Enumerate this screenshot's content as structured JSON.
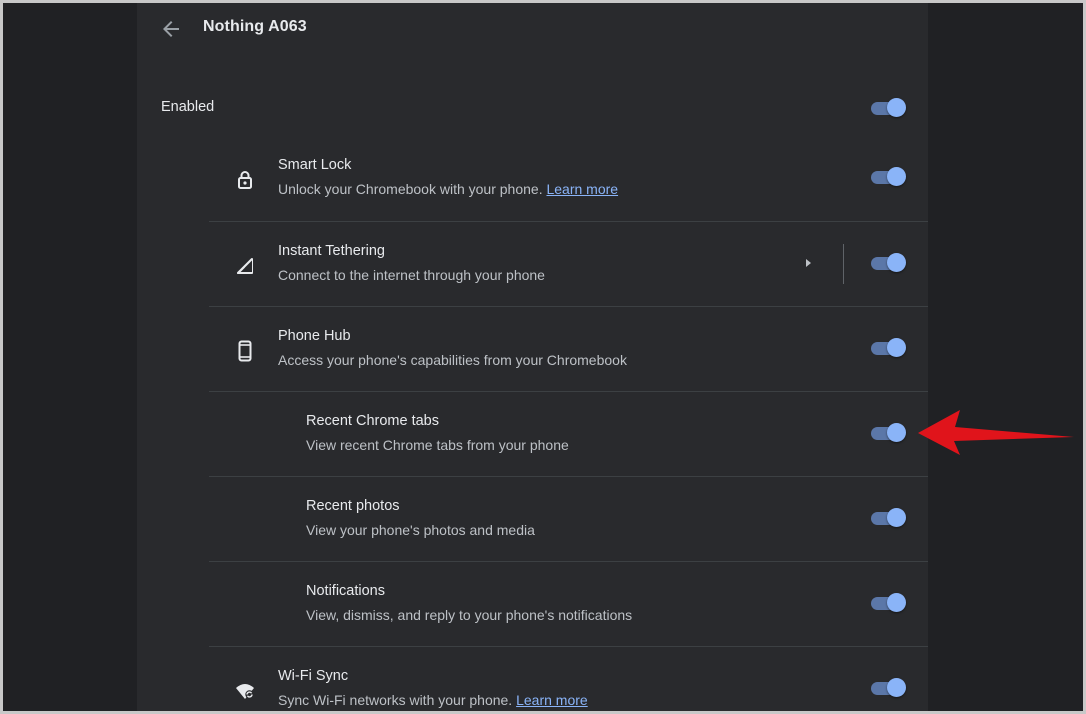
{
  "header": {
    "title": "Nothing A063"
  },
  "enabled": {
    "label": "Enabled",
    "on": true
  },
  "features": [
    {
      "name": "smart-lock",
      "label": "Smart Lock",
      "description": "Unlock your Chromebook with your phone.",
      "link": "Learn more",
      "icon": "lock-icon",
      "on": true
    },
    {
      "name": "instant-tethering",
      "label": "Instant Tethering",
      "description": "Connect to the internet through your phone",
      "icon": "signal-icon",
      "on": true,
      "has_subpage": true
    },
    {
      "name": "phone-hub",
      "label": "Phone Hub",
      "description": "Access your phone's capabilities from your Chromebook",
      "icon": "phone-icon",
      "on": true
    },
    {
      "name": "recent-chrome-tabs",
      "label": "Recent Chrome tabs",
      "description": "View recent Chrome tabs from your phone",
      "on": true
    },
    {
      "name": "recent-photos",
      "label": "Recent photos",
      "description": "View your phone's photos and media",
      "on": true
    },
    {
      "name": "notifications",
      "label": "Notifications",
      "description": "View, dismiss, and reply to your phone's notifications",
      "on": true
    },
    {
      "name": "wifi-sync",
      "label": "Wi-Fi Sync",
      "description": "Sync Wi-Fi networks with your phone.",
      "link": "Learn more",
      "icon": "wifi-sync-icon",
      "on": true
    }
  ],
  "colors": {
    "accent": "#8ab4f8",
    "panel": "#292a2d",
    "background": "#202124",
    "annotation_arrow": "#e0141b"
  }
}
